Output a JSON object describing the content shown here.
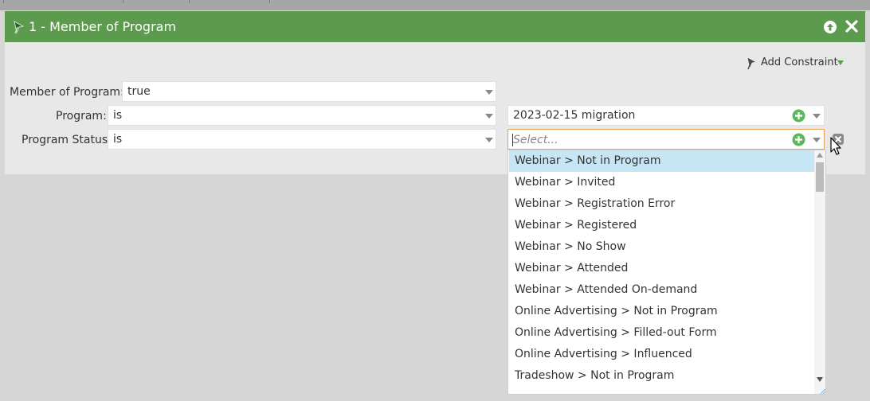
{
  "panel": {
    "title": "1 - Member of Program",
    "header_color": "#5c9a4d",
    "icons": {
      "filter": "wand-icon",
      "move_up": "arrow-up-circle-icon",
      "close": "close-icon"
    }
  },
  "add_constraint": {
    "label": "Add Constraint",
    "icon": "wand-icon",
    "caret_color": "#5c9a4d"
  },
  "rows": {
    "member": {
      "label": "Member of Program:",
      "value": "true"
    },
    "program": {
      "label": "Program:",
      "operator": "is",
      "value": "2023-02-15 migration"
    },
    "status": {
      "label": "Program Status:",
      "operator": "is",
      "placeholder": "Select..."
    }
  },
  "dropdown": {
    "selected_index": 0,
    "highlight_color": "#c7e6f5",
    "items": [
      "Webinar > Not in Program",
      "Webinar > Invited",
      "Webinar > Registration Error",
      "Webinar > Registered",
      "Webinar > No Show",
      "Webinar > Attended",
      "Webinar > Attended On-demand",
      "Online Advertising > Not in Program",
      "Online Advertising > Filled-out Form",
      "Online Advertising > Influenced",
      "Tradeshow > Not in Program"
    ]
  },
  "colors": {
    "focus_border": "#e8a154",
    "add_green": "#5cb85c"
  }
}
